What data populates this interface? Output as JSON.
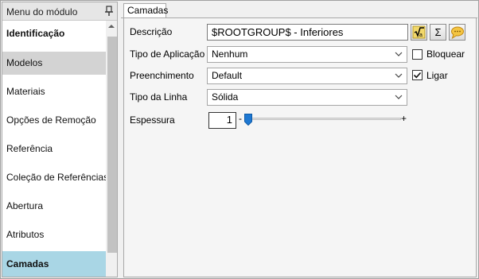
{
  "sidebar": {
    "title": "Menu do módulo",
    "items": [
      {
        "label": "Identificação"
      },
      {
        "label": "Modelos"
      },
      {
        "label": "Materiais"
      },
      {
        "label": "Opções de Remoção"
      },
      {
        "label": "Referência"
      },
      {
        "label": "Coleção de Referências"
      },
      {
        "label": "Abertura"
      },
      {
        "label": "Atributos"
      },
      {
        "label": "Camadas"
      }
    ]
  },
  "tab": {
    "label": "Camadas"
  },
  "form": {
    "descricao_label": "Descrição",
    "descricao_value": "$ROOTGROUP$ - Inferiores",
    "tipo_aplicacao_label": "Tipo de Aplicação",
    "tipo_aplicacao_value": "Nenhum",
    "preenchimento_label": "Preenchimento",
    "preenchimento_value": "Default",
    "tipo_linha_label": "Tipo da Linha",
    "tipo_linha_value": "Sólida",
    "espessura_label": "Espessura",
    "espessura_value": "1",
    "slider_minus": "-",
    "slider_plus": "+",
    "bloquear_label": "Bloquear",
    "bloquear_checked": false,
    "ligar_label": "Ligar",
    "ligar_checked": true,
    "sum_button": "Σ"
  }
}
